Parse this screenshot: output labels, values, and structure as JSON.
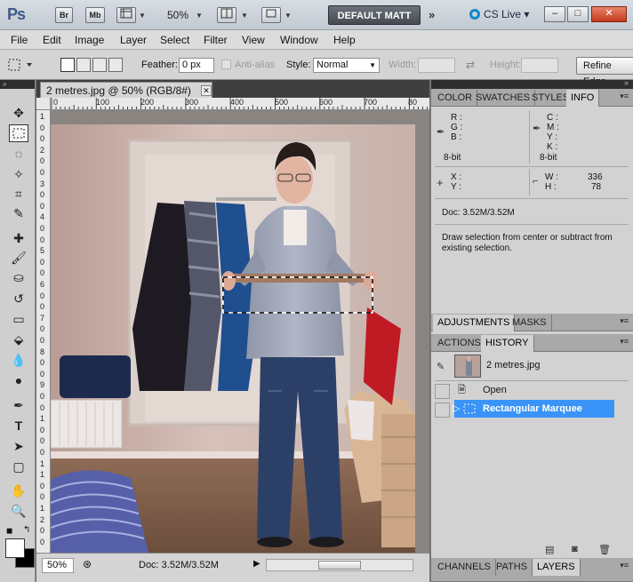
{
  "appbar": {
    "logo": "Ps",
    "bridge_btn": "Br",
    "minibridge_btn": "Mb",
    "zoom": "50%",
    "workspace": "DEFAULT MATT",
    "more": "»",
    "cslive": "CS Live",
    "win_min": "–",
    "win_max": "□",
    "win_close": "✕"
  },
  "menu": [
    "File",
    "Edit",
    "Image",
    "Layer",
    "Select",
    "Filter",
    "View",
    "Window",
    "Help"
  ],
  "options": {
    "feather_label": "Feather:",
    "feather_value": "0 px",
    "antialias_label": "Anti-alias",
    "style_label": "Style:",
    "style_value": "Normal",
    "width_label": "Width:",
    "height_label": "Height:",
    "refine_label": "Refine Edge..."
  },
  "document": {
    "tab_title": "2 metres.jpg @ 50% (RGB/8#)",
    "tab_close": "✕",
    "ruler_h": [
      "0",
      "100",
      "200",
      "300",
      "400",
      "500",
      "600",
      "700",
      "80"
    ],
    "ruler_v": [
      "1",
      "0",
      "0",
      "2",
      "0",
      "0",
      "3",
      "0",
      "0",
      "4",
      "0",
      "0",
      "5",
      "0",
      "0",
      "6",
      "0",
      "0",
      "7",
      "0",
      "0",
      "8",
      "0",
      "0",
      "9",
      "0",
      "0",
      "1",
      "0",
      "0",
      "0",
      "1",
      "1",
      "0",
      "0",
      "1",
      "2",
      "0",
      "0"
    ],
    "status_zoom": "50%",
    "status_doc": "Doc: 3.52M/3.52M"
  },
  "info_panel": {
    "tabs": [
      "COLOR",
      "SWATCHES",
      "STYLES",
      "INFO"
    ],
    "active_tab": "INFO",
    "rgb_labels": [
      "R :",
      "G :",
      "B :"
    ],
    "cmyk_labels": [
      "C :",
      "M :",
      "Y :",
      "K :"
    ],
    "bitdepth_left": "8-bit",
    "bitdepth_right": "8-bit",
    "x_label": "X :",
    "y_label": "Y :",
    "w_label": "W :",
    "h_label": "H :",
    "w_value": "336",
    "h_value": "78",
    "doc_size": "Doc: 3.52M/3.52M",
    "hint": "Draw selection from center or subtract from existing selection."
  },
  "adjust_panel": {
    "tabs": [
      "ADJUSTMENTS",
      "MASKS"
    ],
    "active_tab": "ADJUSTMENTS"
  },
  "history_panel": {
    "tabs": [
      "ACTIONS",
      "HISTORY"
    ],
    "active_tab": "HISTORY",
    "snapshot": "2 metres.jpg",
    "items": [
      {
        "label": "Open",
        "selected": false
      },
      {
        "label": "Rectangular Marquee",
        "selected": true
      }
    ]
  },
  "layers_panel": {
    "tabs": [
      "CHANNELS",
      "PATHS",
      "LAYERS"
    ],
    "active_tab": "LAYERS"
  },
  "colors": {
    "accent": "#3a94f7",
    "workspace_btn": "#4f545c"
  }
}
